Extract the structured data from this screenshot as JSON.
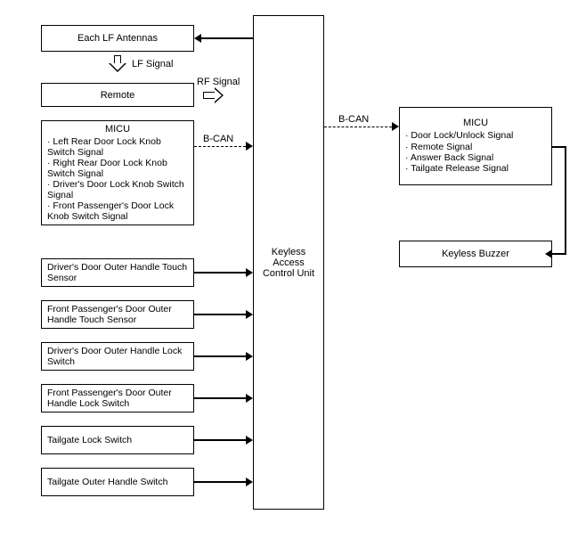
{
  "left": {
    "antennas": "Each LF Antennas",
    "remote": "Remote",
    "micu_title": "MICU",
    "micu_items": [
      "Left Rear Door Lock Knob Switch Signal",
      "Right Rear Door Lock Knob Switch Signal",
      "Driver's Door Lock Knob Switch Signal",
      "Front Passenger's Door Lock Knob Switch Signal"
    ],
    "sensors": [
      "Driver's Door Outer Handle Touch Sensor",
      "Front Passenger's Door Outer Handle Touch Sensor",
      "Driver's Door Outer Handle Lock Switch",
      "Front Passenger's Door Outer Handle Lock Switch",
      "Tailgate Lock Switch",
      "Tailgate Outer Handle Switch"
    ]
  },
  "center": {
    "kacu": "Keyless Access Control Unit"
  },
  "right": {
    "micu_title": "MICU",
    "micu_items": [
      "Door Lock/Unlock Signal",
      "Remote Signal",
      "Answer Back Signal",
      "Tailgate Release Signal"
    ],
    "buzzer": "Keyless Buzzer"
  },
  "labels": {
    "lf_signal": "LF Signal",
    "rf_signal": "RF Signal",
    "bcan": "B-CAN"
  }
}
